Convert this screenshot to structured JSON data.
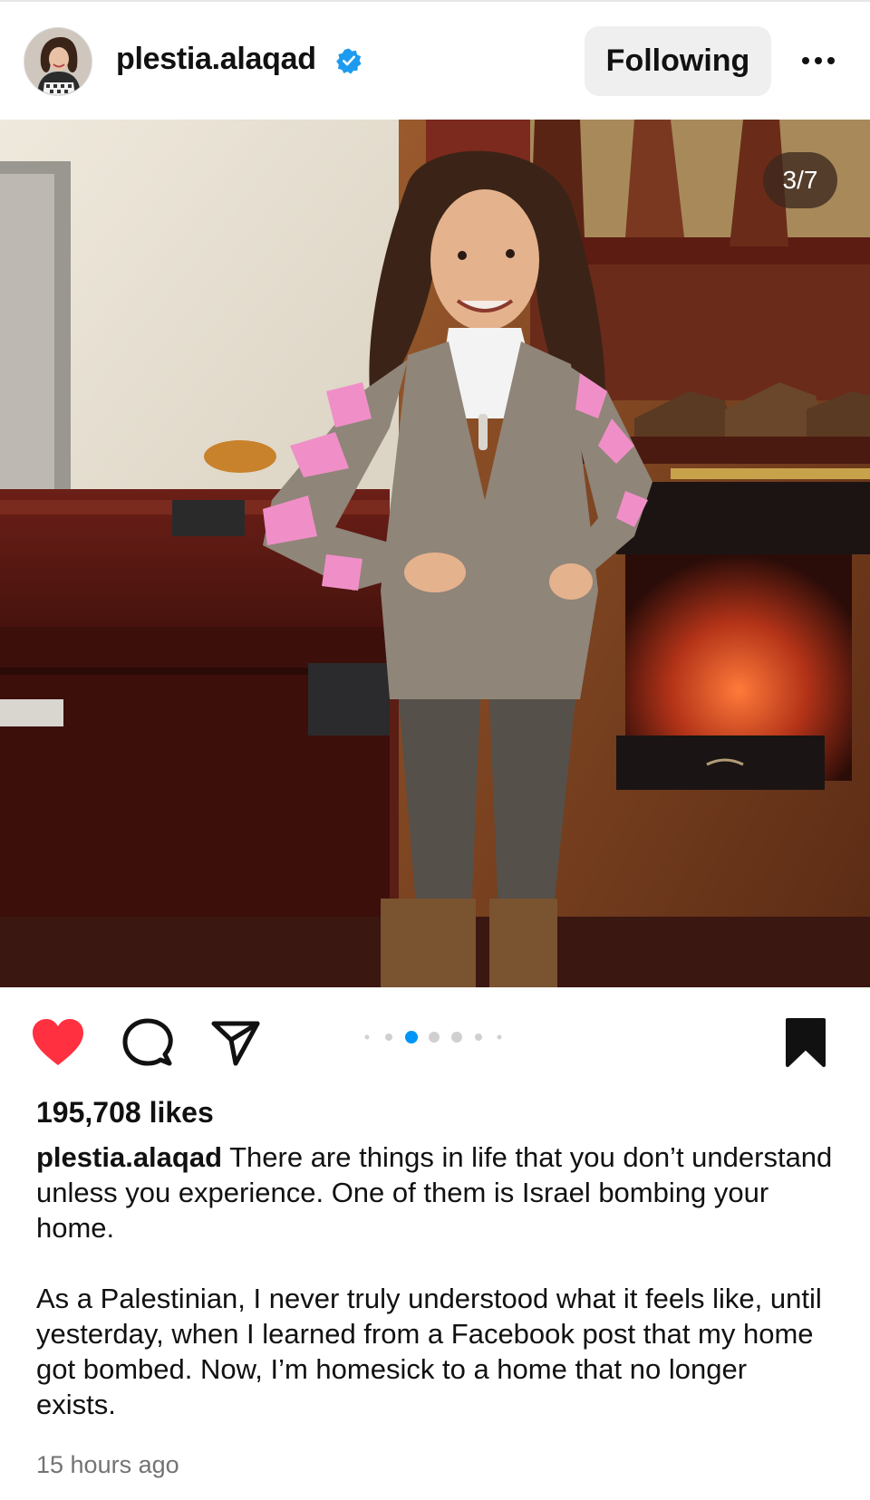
{
  "post": {
    "username": "plestia.alaqad",
    "follow_label": "Following",
    "image_counter": "3/7",
    "likes": "195,708 likes",
    "caption_user": "plestia.alaqad",
    "caption_p1": "There are things in life that you don’t understand unless you experience. One of them is Israel bombing your home.",
    "caption_p2": "As a Palestinian, I never truly understood what it feels like, until yesterday, when I learned from a Facebook post that my home got bombed. Now, I’m homesick to a home that no longer exists.",
    "timestamp": "15 hours ago"
  },
  "icons": {
    "verified": "verified-badge-icon",
    "more": "more-options-icon",
    "like": "heart-filled-icon",
    "comment": "comment-icon",
    "share": "share-icon",
    "save": "bookmark-filled-icon"
  },
  "carousel": {
    "active_index": 2,
    "dot_count": 7
  },
  "colors": {
    "verified_blue": "#1d9bf0",
    "like_red": "#ff3040",
    "active_dot": "#0095f6",
    "inactive_dot": "#d0d0d0",
    "follow_bg": "#efefef",
    "muted_text": "#737373"
  }
}
